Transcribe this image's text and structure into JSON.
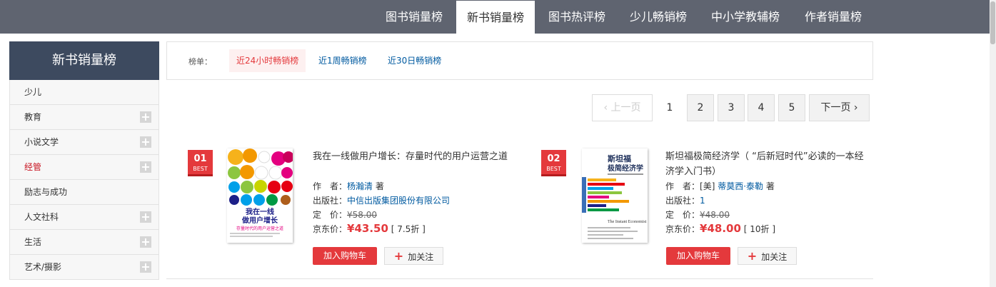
{
  "top_nav": {
    "tabs": [
      {
        "label": "图书销量榜",
        "active": false
      },
      {
        "label": "新书销量榜",
        "active": true
      },
      {
        "label": "图书热评榜",
        "active": false
      },
      {
        "label": "少儿畅销榜",
        "active": false
      },
      {
        "label": "中小学教辅榜",
        "active": false
      },
      {
        "label": "作者销量榜",
        "active": false
      }
    ]
  },
  "sidebar": {
    "title": "新书销量榜",
    "items": [
      {
        "label": "少儿",
        "expandable": false
      },
      {
        "label": "教育",
        "expandable": true
      },
      {
        "label": "小说文学",
        "expandable": true
      },
      {
        "label": "经管",
        "expandable": true,
        "highlight": true
      },
      {
        "label": "励志与成功",
        "expandable": false
      },
      {
        "label": "人文社科",
        "expandable": true
      },
      {
        "label": "生活",
        "expandable": true
      },
      {
        "label": "艺术/摄影",
        "expandable": true
      }
    ]
  },
  "filter": {
    "label": "榜单：",
    "options": [
      "近24小时畅销榜",
      "近1周畅销榜",
      "近30日畅销榜"
    ],
    "active": "近24小时畅销榜"
  },
  "pager": {
    "prev": "上一页",
    "pages": [
      "1",
      "2",
      "3",
      "4",
      "5"
    ],
    "current": "1",
    "next": "下一页"
  },
  "products": [
    {
      "rank": "01",
      "rank_tag": "BEST",
      "title": "我在一线做用户增长：存量时代的用户运营之道",
      "author_label": "作　者：",
      "author": "杨瀚清",
      "author_suffix": "著",
      "publisher_label": "出版社：",
      "publisher": "中信出版集团股份有限公司",
      "list_price_label": "定　价：",
      "list_price": "¥58.00",
      "jd_price_label": "京东价：",
      "jd_price": "¥43.50",
      "discount": "[ 7.5折 ]",
      "cover_title": "我在一线做用户增长",
      "cover_subtitle": "存量时代的用户运营之道"
    },
    {
      "rank": "02",
      "rank_tag": "BEST",
      "title": "斯坦福极简经济学（ “后新冠时代”必读的一本经济学入门书）",
      "author_label": "作　者：",
      "author_prefix": "[美]",
      "author": "蒂莫西·泰勒",
      "author_suffix": "著",
      "publisher_label": "出版社：",
      "publisher": "1",
      "list_price_label": "定　价：",
      "list_price": "¥48.00",
      "jd_price_label": "京东价：",
      "jd_price": "¥48.00",
      "discount": "[ 10折 ]",
      "cover_title": "斯坦福极简经济学",
      "cover_subtitle": "The Instant Economist"
    }
  ],
  "buttons": {
    "add_to_cart": "加入购物车",
    "follow": "加关注",
    "follow_icon": "plus-icon"
  },
  "colors": {
    "topbar": "#5f6470",
    "sidebar_head": "#3d4a5f",
    "accent_red": "#e4393c",
    "link_blue": "#005aa0"
  }
}
